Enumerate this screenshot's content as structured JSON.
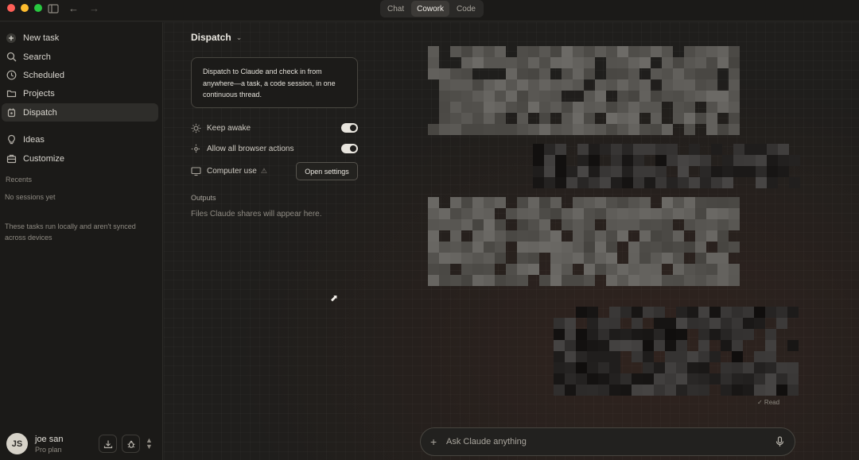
{
  "window": {
    "mode_tabs": [
      {
        "label": "Chat",
        "active": false
      },
      {
        "label": "Cowork",
        "active": true
      },
      {
        "label": "Code",
        "active": false
      }
    ]
  },
  "sidebar": {
    "items": [
      {
        "label": "New task",
        "icon": "plus-circle-icon"
      },
      {
        "label": "Search",
        "icon": "search-icon"
      },
      {
        "label": "Scheduled",
        "icon": "clock-icon"
      },
      {
        "label": "Projects",
        "icon": "folder-icon"
      },
      {
        "label": "Dispatch",
        "icon": "dispatch-icon",
        "active": true
      },
      {
        "label": "Ideas",
        "icon": "lightbulb-icon"
      },
      {
        "label": "Customize",
        "icon": "briefcase-icon"
      }
    ],
    "recents_label": "Recents",
    "no_sessions": "No sessions yet",
    "local_note": "These tasks run locally and aren't synced across devices",
    "user": {
      "initials": "JS",
      "name": "joe san",
      "plan": "Pro plan"
    }
  },
  "main": {
    "title": "Dispatch",
    "info_card": "Dispatch to Claude and check in from anywhere—a task, a code session, in one continuous thread.",
    "options": [
      {
        "label": "Keep awake",
        "icon": "sun-icon",
        "toggle_on": true
      },
      {
        "label": "Allow all browser actions",
        "icon": "sparkle-icon",
        "toggle_on": true
      },
      {
        "label": "Computer use",
        "icon": "monitor-icon"
      }
    ],
    "open_settings": "Open settings",
    "outputs_label": "Outputs",
    "outputs_empty": "Files Claude shares will appear here.",
    "read_receipt": "✓ Read",
    "composer_placeholder": "Ask Claude anything"
  },
  "colors": {
    "background": "#1f1e1c",
    "sidebar": "#1b1a18",
    "accent_active": "#2e2d2a",
    "toggle_on": "#e8e5de"
  }
}
